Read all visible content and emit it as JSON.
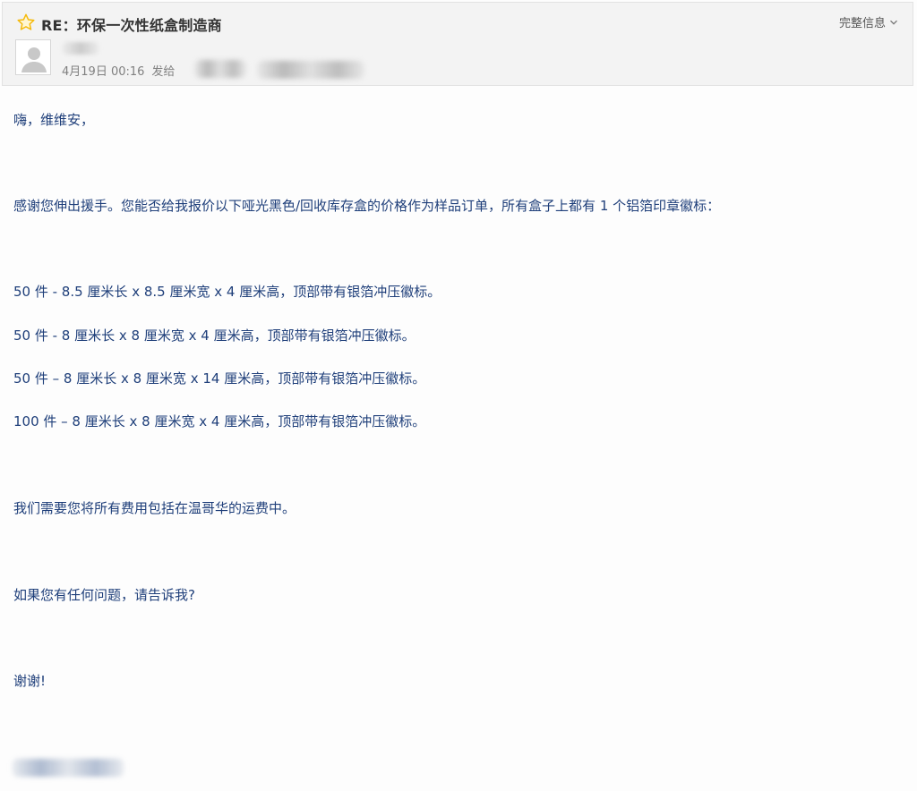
{
  "header": {
    "subject": "RE：环保一次性纸盒制造商",
    "full_info_label": "完整信息",
    "date_time": "4月19日 00:16",
    "sent_label": "发给",
    "star_color": "#f5b90a"
  },
  "body": {
    "greeting": "嗨，维维安，",
    "intro": "感谢您伸出援手。您能否给我报价以下哑光黑色/回收库存盒的价格作为样品订单，所有盒子上都有 1 个铝箔印章徽标：",
    "items": [
      "50 件 - 8.5 厘米长 x 8.5 厘米宽 x 4 厘米高，顶部带有银箔冲压徽标。",
      "50 件 - 8 厘米长 x 8 厘米宽 x 4 厘米高，顶部带有银箔冲压徽标。",
      "50 件 – 8 厘米长 x 8 厘米宽 x 14 厘米高，顶部带有银箔冲压徽标。",
      "100 件 – 8 厘米长 x 8 厘米宽 x 4 厘米高，顶部带有银箔冲压徽标。"
    ],
    "shipping": "我们需要您将所有费用包括在温哥华的运费中。",
    "questions": "如果您有任何问题，请告诉我?",
    "thanks": "谢谢!"
  },
  "colors": {
    "body_text": "#1f3f7a",
    "header_bg": "#f3f3f3"
  }
}
